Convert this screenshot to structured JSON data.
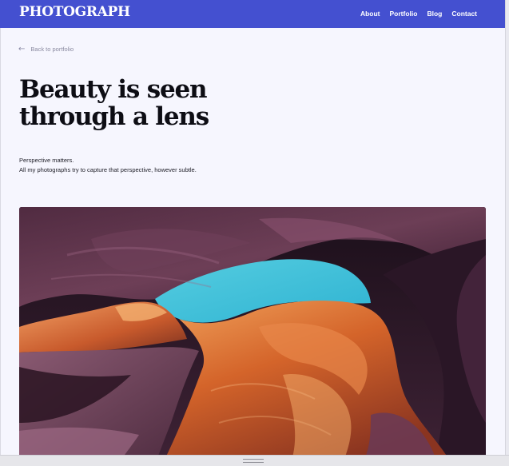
{
  "header": {
    "logo": "PHOTOGRAPH",
    "nav": [
      {
        "label": "About"
      },
      {
        "label": "Portfolio"
      },
      {
        "label": "Blog"
      },
      {
        "label": "Contact"
      }
    ]
  },
  "back_link": {
    "icon": "arrow-left-icon",
    "label": "Back to portfolio"
  },
  "article": {
    "headline_line1": "Beauty is seen",
    "headline_line2": "through a lens",
    "intro_line1": "Perspective matters.",
    "intro_line2": "All my photographs try to capture that perspective, however subtle."
  },
  "hero_image": {
    "subject": "canyon-photo"
  },
  "colors": {
    "nav_bg": "#4450d0",
    "page_bg": "#f6f6fe",
    "text": "#0d0d14"
  }
}
